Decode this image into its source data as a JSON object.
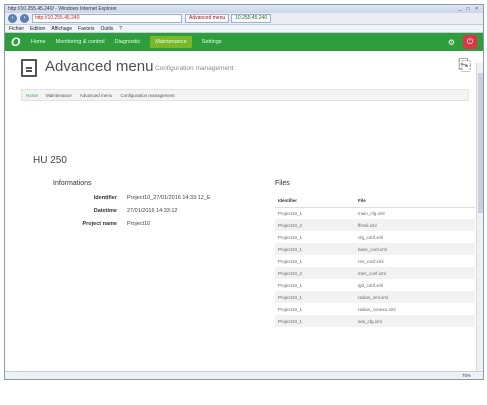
{
  "browser": {
    "titlebar_text": "http://10.255.45.240/ - Windows Internet Explorer",
    "window_controls": "_ □ ×",
    "address": "http://10.255.45.240",
    "tabs": [
      "Advanced menu",
      "10.255.45.240"
    ],
    "menu": [
      "Fichier",
      "Edition",
      "Affichage",
      "Favoris",
      "Outils",
      "?"
    ]
  },
  "appnav": {
    "items": [
      "Home",
      "Monitoring & control",
      "Diagnostic",
      "Maintenance",
      "Settings"
    ],
    "active": "Maintenance"
  },
  "page": {
    "title": "Advanced menu",
    "subtitle": "Configuration management"
  },
  "breadcrumb": [
    "Home",
    "Maintenance",
    "Advanced menu",
    "Configuration management"
  ],
  "device": {
    "name": "HU 250"
  },
  "informations": {
    "heading": "Informations",
    "rows": [
      {
        "key": "Identifier",
        "value": "Project10_27/01/2016 14:33:12_E"
      },
      {
        "key": "Datetime",
        "value": "27/01/2016 14:33:12"
      },
      {
        "key": "Project name",
        "value": "Project10"
      }
    ]
  },
  "files": {
    "heading": "Files",
    "columns": [
      "Identifier",
      "File"
    ],
    "rows": [
      [
        "Project10_1",
        "main_cfg.xml"
      ],
      [
        "Project10_2",
        "ffmsil.xml"
      ],
      [
        "Project10_1",
        "cfg_conf.xml"
      ],
      [
        "Project10_1",
        "base_conf.xml"
      ],
      [
        "Project10_1",
        "res_conf.xml"
      ],
      [
        "Project10_2",
        "mes_conf.xml"
      ],
      [
        "Project10_1",
        "lgd_conf.xml"
      ],
      [
        "Project10_1",
        "radios_xml.xml"
      ],
      [
        "Project10_1",
        "radios_conexo.xml"
      ],
      [
        "Project10_1",
        "ass_cfg.xml"
      ]
    ]
  },
  "status": {
    "zoom": "75%"
  }
}
